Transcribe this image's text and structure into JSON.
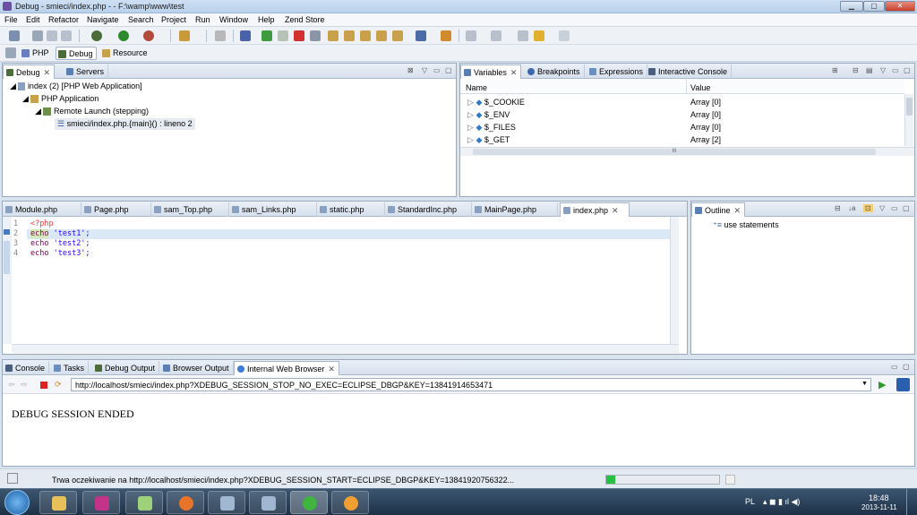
{
  "window": {
    "title": "Debug - smieci/index.php - - F:\\wamp\\www\\test"
  },
  "menu": [
    "File",
    "Edit",
    "Refactor",
    "Navigate",
    "Search",
    "Project",
    "Run",
    "Window",
    "Help",
    "Zend Store"
  ],
  "perspectives": {
    "php": "PHP",
    "debug": "Debug",
    "resource": "Resource"
  },
  "debug_view": {
    "tabs": {
      "debug": "Debug",
      "servers": "Servers"
    },
    "tree": [
      "index (2) [PHP Web Application]",
      "PHP Application",
      "Remote Launch (stepping)",
      "smieci/index.php.{main}() : lineno 2"
    ]
  },
  "variables_view": {
    "tabs": {
      "variables": "Variables",
      "breakpoints": "Breakpoints",
      "expressions": "Expressions",
      "console": "Interactive Console"
    },
    "columns": {
      "name": "Name",
      "value": "Value"
    },
    "rows": [
      {
        "name": "$_COOKIE",
        "value": "Array [0]"
      },
      {
        "name": "$_ENV",
        "value": "Array [0]"
      },
      {
        "name": "$_FILES",
        "value": "Array [0]"
      },
      {
        "name": "$_GET",
        "value": "Array [2]"
      }
    ],
    "hscroll_mark": "III"
  },
  "editor": {
    "tabs": [
      "Module.php",
      "Page.php",
      "sam_Top.php",
      "sam_Links.php",
      "static.php",
      "StandardInc.php",
      "MainPage.php",
      "index.php"
    ],
    "line_numbers": [
      "1",
      "2",
      "3",
      "4"
    ],
    "lines": {
      "l1": "<?php",
      "l2_kw": "echo",
      "l2_str": " 'test1';",
      "l3_kw": "echo",
      "l3_str": " 'test2';",
      "l4_kw": "echo",
      "l4_str": " 'test3';"
    }
  },
  "outline": {
    "tab": "Outline",
    "item": "use statements"
  },
  "bottom": {
    "tabs": {
      "console": "Console",
      "tasks": "Tasks",
      "debug_output": "Debug Output",
      "browser_output": "Browser Output",
      "web_browser": "Internal Web Browser"
    },
    "url": "http://localhost/smieci/index.php?XDEBUG_SESSION_STOP_NO_EXEC=ECLIPSE_DBGP&KEY=13841914653471",
    "content": "DEBUG SESSION ENDED"
  },
  "status": {
    "text": "Trwa oczekiwanie na http://localhost/smieci/index.php?XDEBUG_SESSION_START=ECLIPSE_DBGP&KEY=13841920756322...",
    "progress": 0.08
  },
  "taskbar": {
    "lang": "PL",
    "time": "18:48",
    "date": "2013-11-11"
  },
  "colors": {
    "keyword": "#7f0055",
    "string": "#2a00ff",
    "php_tag": "#ff3b3b",
    "current_line": "#dbe9f7"
  }
}
